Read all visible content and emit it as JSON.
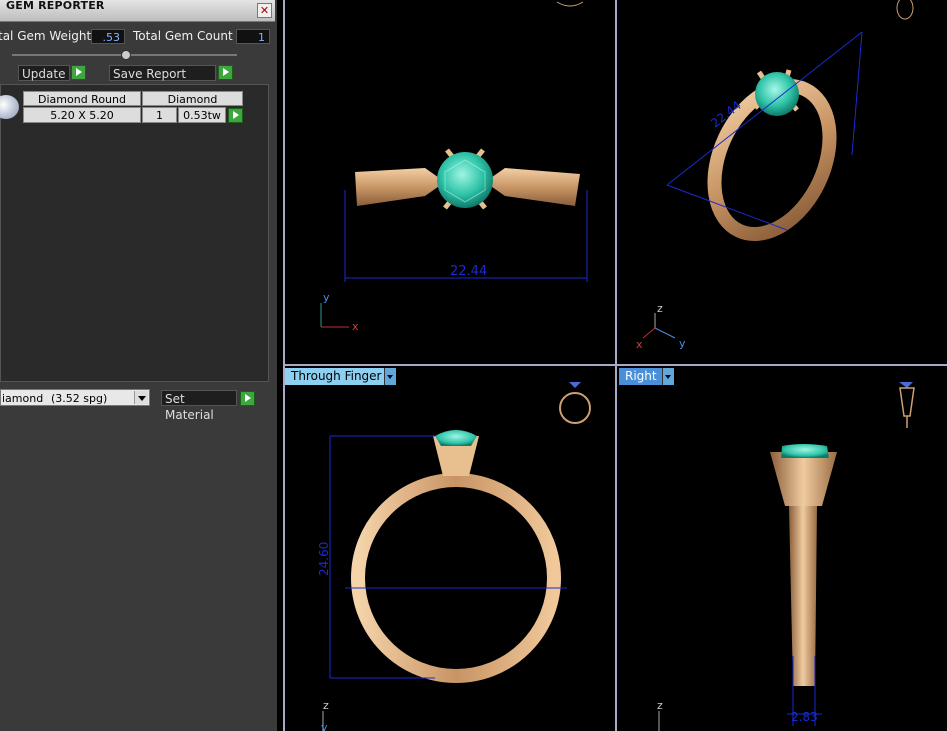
{
  "panel": {
    "title": "GEM REPORTER",
    "close_glyph": "✕",
    "total_weight_label": "tal Gem Weight",
    "total_weight_value": ".53",
    "total_count_label": "Total Gem Count",
    "total_count_value": "1",
    "update_label": "Update",
    "save_report_label": "Save Report",
    "table": {
      "headers": [
        "Diamond Round",
        "Diamond"
      ],
      "row": {
        "size": "5.20 X 5.20",
        "count": "1",
        "weight": "0.53tw"
      }
    },
    "material_select": {
      "name": "iamond",
      "spg": "(3.52 spg)"
    },
    "set_material_label": "Set Material"
  },
  "viewports": {
    "top_left": {
      "dimension": "22.44",
      "axis_y": "y",
      "axis_x": "x"
    },
    "top_right": {
      "dimension": "22.44",
      "axis_z": "z",
      "axis_x": "x",
      "axis_y": "y"
    },
    "bottom_left": {
      "tab_label": "Through Finger",
      "dimension": "24.60",
      "axis_z": "z",
      "axis_y": "y"
    },
    "bottom_right": {
      "tab_label": "Right",
      "dimension": "2.83",
      "axis_z": "z"
    }
  },
  "colors": {
    "panel_bg": "#3a3a3a",
    "viewport_bg": "#000000",
    "gold": "#d9a878",
    "gem": "#3fd6b8",
    "dimension_line": "#1a2ad0",
    "tab_blue": "#8ccff0",
    "go_green": "#3fa53f"
  }
}
